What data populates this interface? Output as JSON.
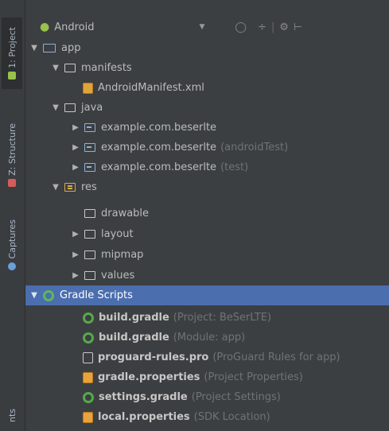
{
  "sidebar": {
    "tabs": [
      {
        "label": "1: Project"
      },
      {
        "label": "Z: Structure"
      },
      {
        "label": "Captures"
      },
      {
        "label": "nts"
      }
    ]
  },
  "header": {
    "view_label": "Android",
    "icons": [
      "sync-icon",
      "collapse-icon",
      "settings-icon",
      "hide-icon"
    ]
  },
  "tree": {
    "app": "app",
    "manifests": "manifests",
    "manifest_file": "AndroidManifest.xml",
    "java": "java",
    "packages": [
      {
        "name": "example.com.beserlte",
        "suffix": ""
      },
      {
        "name": "example.com.beserlte",
        "suffix": "(androidTest)"
      },
      {
        "name": "example.com.beserlte",
        "suffix": "(test)"
      }
    ],
    "res": "res",
    "res_dirs": [
      "drawable",
      "layout",
      "mipmap",
      "values"
    ],
    "gradle_scripts": "Gradle Scripts",
    "gradle_files": [
      {
        "name": "build.gradle",
        "suffix": "(Project: BeSerLTE)"
      },
      {
        "name": "build.gradle",
        "suffix": "(Module: app)"
      },
      {
        "name": "proguard-rules.pro",
        "suffix": "(ProGuard Rules for app)"
      },
      {
        "name": "gradle.properties",
        "suffix": "(Project Properties)"
      },
      {
        "name": "settings.gradle",
        "suffix": "(Project Settings)"
      },
      {
        "name": "local.properties",
        "suffix": "(SDK Location)"
      }
    ]
  },
  "colors": {
    "background": "#3c3f41",
    "selection": "#4b6eaf",
    "android_green": "#97c24b"
  }
}
